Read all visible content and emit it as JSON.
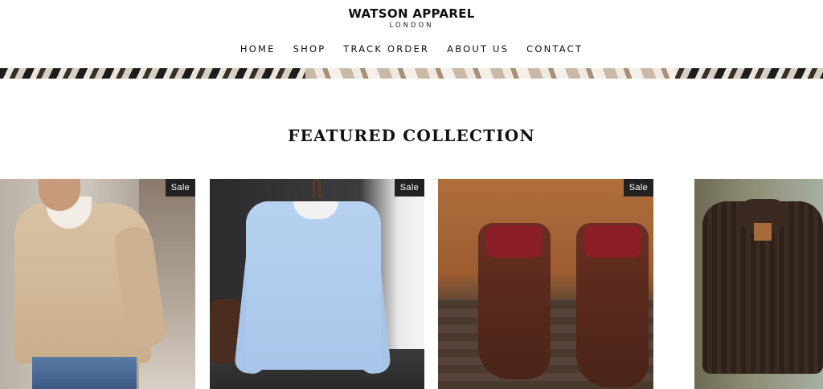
{
  "header": {
    "brand": "WATSON APPAREL",
    "brand_sub": "LONDON"
  },
  "nav": {
    "items": [
      "HOME",
      "SHOP",
      "TRACK ORDER",
      "ABOUT US",
      "CONTACT"
    ]
  },
  "featured": {
    "title": "FEATURED COLLECTION",
    "products": [
      {
        "badge": "Sale"
      },
      {
        "badge": "Sale"
      },
      {
        "badge": "Sale"
      },
      {
        "badge": ""
      }
    ]
  }
}
